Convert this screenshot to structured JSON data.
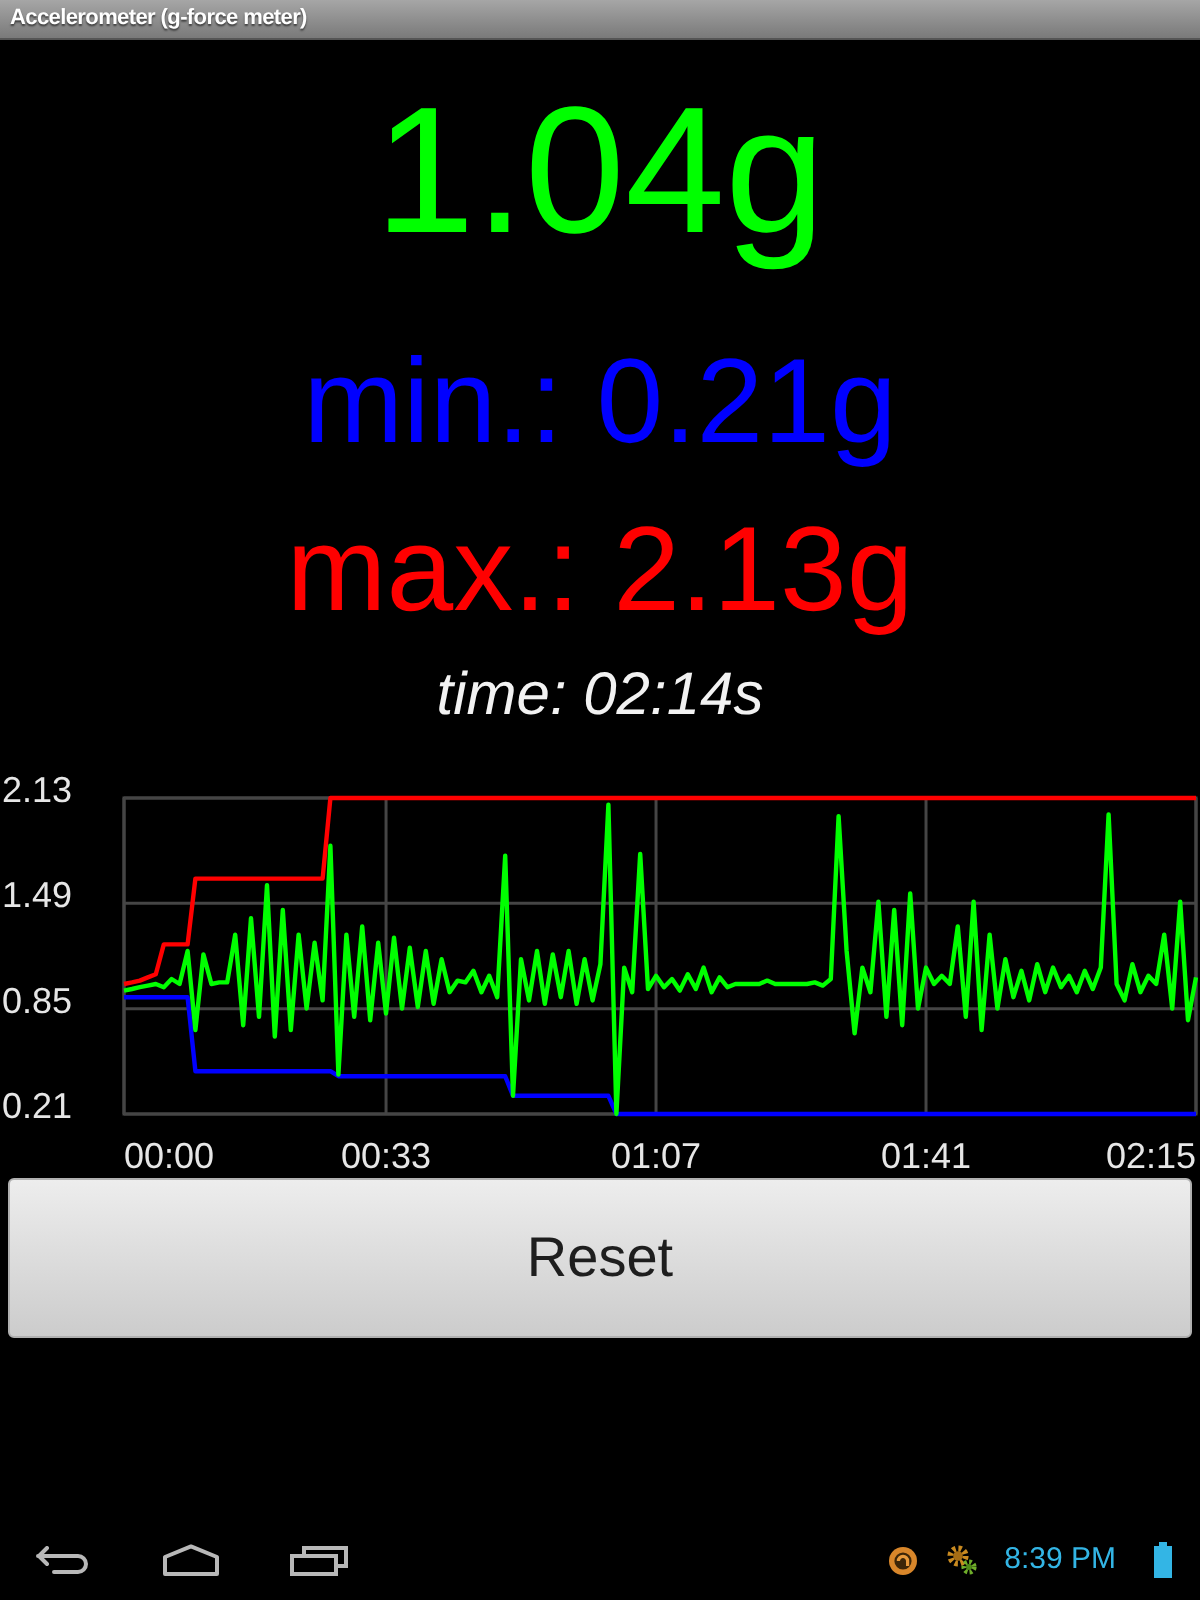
{
  "window": {
    "title": "Accelerometer (g-force meter)"
  },
  "readings": [
    {
      "kind": "current",
      "text": "1.04g",
      "color": "#00ff00"
    },
    {
      "kind": "min",
      "text": "min.: 0.21g",
      "color": "#0000ff"
    },
    {
      "kind": "max",
      "text": "max.: 2.13g",
      "color": "#ff0000"
    }
  ],
  "time": "time: 02:14s",
  "chart": {
    "chart_data": {
      "type": "line",
      "grid": true,
      "x": [
        0,
        1,
        2,
        3,
        4,
        5,
        6,
        7,
        8,
        9,
        10,
        11,
        12,
        13,
        14,
        15,
        16,
        17,
        18,
        19,
        20,
        21,
        22,
        23,
        24,
        25,
        26,
        27,
        28,
        29,
        30,
        31,
        32,
        33,
        34,
        35,
        36,
        37,
        38,
        39,
        40,
        41,
        42,
        43,
        44,
        45,
        46,
        47,
        48,
        49,
        50,
        51,
        52,
        53,
        54,
        55,
        56,
        57,
        58,
        59,
        60,
        61,
        62,
        63,
        64,
        65,
        66,
        67,
        68,
        69,
        70,
        71,
        72,
        73,
        74,
        75,
        76,
        77,
        78,
        79,
        80,
        81,
        82,
        83,
        84,
        85,
        86,
        87,
        88,
        89,
        90,
        91,
        92,
        93,
        94,
        95,
        96,
        97,
        98,
        99,
        100,
        101,
        102,
        103,
        104,
        105,
        106,
        107,
        108,
        109,
        110,
        111,
        112,
        113,
        114,
        115,
        116,
        117,
        118,
        119,
        120,
        121,
        122,
        123,
        124,
        125,
        126,
        127,
        128,
        129,
        130,
        131,
        132,
        133,
        134,
        135
      ],
      "series": [
        {
          "color": "#ff0000",
          "values": [
            1.0,
            1.01,
            1.02,
            1.04,
            1.06,
            1.24,
            1.24,
            1.24,
            1.24,
            1.64,
            1.64,
            1.64,
            1.64,
            1.64,
            1.64,
            1.64,
            1.64,
            1.64,
            1.64,
            1.64,
            1.64,
            1.64,
            1.64,
            1.64,
            1.64,
            1.64,
            2.13,
            2.13,
            2.13,
            2.13,
            2.13,
            2.13,
            2.13,
            2.13,
            2.13,
            2.13,
            2.13,
            2.13,
            2.13,
            2.13,
            2.13,
            2.13,
            2.13,
            2.13,
            2.13,
            2.13,
            2.13,
            2.13,
            2.13,
            2.13,
            2.13,
            2.13,
            2.13,
            2.13,
            2.13,
            2.13,
            2.13,
            2.13,
            2.13,
            2.13,
            2.13,
            2.13,
            2.13,
            2.13,
            2.13,
            2.13,
            2.13,
            2.13,
            2.13,
            2.13,
            2.13,
            2.13,
            2.13,
            2.13,
            2.13,
            2.13,
            2.13,
            2.13,
            2.13,
            2.13,
            2.13,
            2.13,
            2.13,
            2.13,
            2.13,
            2.13,
            2.13,
            2.13,
            2.13,
            2.13,
            2.13,
            2.13,
            2.13,
            2.13,
            2.13,
            2.13,
            2.13,
            2.13,
            2.13,
            2.13,
            2.13,
            2.13,
            2.13,
            2.13,
            2.13,
            2.13,
            2.13,
            2.13,
            2.13,
            2.13,
            2.13,
            2.13,
            2.13,
            2.13,
            2.13,
            2.13,
            2.13,
            2.13,
            2.13,
            2.13,
            2.13,
            2.13,
            2.13,
            2.13,
            2.13,
            2.13,
            2.13,
            2.13,
            2.13,
            2.13,
            2.13,
            2.13,
            2.13,
            2.13,
            2.13,
            2.13
          ]
        },
        {
          "color": "#0000ff",
          "values": [
            0.92,
            0.92,
            0.92,
            0.92,
            0.92,
            0.92,
            0.92,
            0.92,
            0.92,
            0.47,
            0.47,
            0.47,
            0.47,
            0.47,
            0.47,
            0.47,
            0.47,
            0.47,
            0.47,
            0.47,
            0.47,
            0.47,
            0.47,
            0.47,
            0.47,
            0.47,
            0.47,
            0.44,
            0.44,
            0.44,
            0.44,
            0.44,
            0.44,
            0.44,
            0.44,
            0.44,
            0.44,
            0.44,
            0.44,
            0.44,
            0.44,
            0.44,
            0.44,
            0.44,
            0.44,
            0.44,
            0.44,
            0.44,
            0.44,
            0.32,
            0.32,
            0.32,
            0.32,
            0.32,
            0.32,
            0.32,
            0.32,
            0.32,
            0.32,
            0.32,
            0.32,
            0.32,
            0.21,
            0.21,
            0.21,
            0.21,
            0.21,
            0.21,
            0.21,
            0.21,
            0.21,
            0.21,
            0.21,
            0.21,
            0.21,
            0.21,
            0.21,
            0.21,
            0.21,
            0.21,
            0.21,
            0.21,
            0.21,
            0.21,
            0.21,
            0.21,
            0.21,
            0.21,
            0.21,
            0.21,
            0.21,
            0.21,
            0.21,
            0.21,
            0.21,
            0.21,
            0.21,
            0.21,
            0.21,
            0.21,
            0.21,
            0.21,
            0.21,
            0.21,
            0.21,
            0.21,
            0.21,
            0.21,
            0.21,
            0.21,
            0.21,
            0.21,
            0.21,
            0.21,
            0.21,
            0.21,
            0.21,
            0.21,
            0.21,
            0.21,
            0.21,
            0.21,
            0.21,
            0.21,
            0.21,
            0.21,
            0.21,
            0.21,
            0.21,
            0.21,
            0.21,
            0.21,
            0.21,
            0.21,
            0.21,
            0.21
          ]
        },
        {
          "color": "#00ff00",
          "values": [
            0.96,
            0.97,
            0.98,
            0.99,
            1.0,
            0.98,
            1.03,
            1.0,
            1.2,
            0.72,
            1.18,
            1.0,
            1.01,
            1.01,
            1.3,
            0.75,
            1.4,
            0.8,
            1.6,
            0.68,
            1.45,
            0.72,
            1.3,
            0.85,
            1.25,
            0.9,
            1.84,
            0.45,
            1.3,
            0.8,
            1.35,
            0.78,
            1.25,
            0.82,
            1.28,
            0.85,
            1.22,
            0.86,
            1.2,
            0.88,
            1.15,
            0.95,
            1.02,
            1.01,
            1.08,
            0.95,
            1.05,
            0.92,
            1.78,
            0.32,
            1.15,
            0.9,
            1.2,
            0.88,
            1.18,
            0.92,
            1.2,
            0.88,
            1.15,
            0.9,
            1.12,
            2.09,
            0.21,
            1.1,
            0.95,
            1.79,
            0.97,
            1.05,
            0.98,
            1.03,
            0.96,
            1.06,
            0.97,
            1.1,
            0.95,
            1.04,
            0.98,
            1.0,
            1.0,
            1.0,
            1.0,
            1.02,
            1.0,
            1.0,
            1.0,
            1.0,
            1.0,
            1.01,
            0.99,
            1.03,
            2.02,
            1.2,
            0.7,
            1.1,
            0.95,
            1.5,
            0.8,
            1.45,
            0.75,
            1.55,
            0.85,
            1.1,
            1.0,
            1.05,
            1.0,
            1.35,
            0.8,
            1.5,
            0.72,
            1.3,
            0.85,
            1.15,
            0.92,
            1.08,
            0.9,
            1.12,
            0.95,
            1.1,
            0.98,
            1.05,
            0.95,
            1.08,
            0.97,
            1.1,
            2.03,
            1.0,
            0.9,
            1.12,
            0.95,
            1.05,
            1.0,
            1.3,
            0.85,
            1.5,
            0.78,
            1.04
          ]
        }
      ],
      "xlim": [
        0,
        135
      ],
      "ylim": [
        0.21,
        2.13
      ],
      "xticks": [
        {
          "value": 0,
          "label": "00:00"
        },
        {
          "value": 33,
          "label": "00:33"
        },
        {
          "value": 67,
          "label": "01:07"
        },
        {
          "value": 101,
          "label": "01:41"
        },
        {
          "value": 135,
          "label": "02:15"
        }
      ],
      "yticks": [
        {
          "value": 2.13,
          "label": "2.13"
        },
        {
          "value": 1.49,
          "label": "1.49"
        },
        {
          "value": 0.85,
          "label": "0.85"
        },
        {
          "value": 0.21,
          "label": "0.21"
        }
      ]
    }
  },
  "reset_button": {
    "label": "Reset"
  },
  "status_bar": {
    "clock": "8:39 PM"
  }
}
